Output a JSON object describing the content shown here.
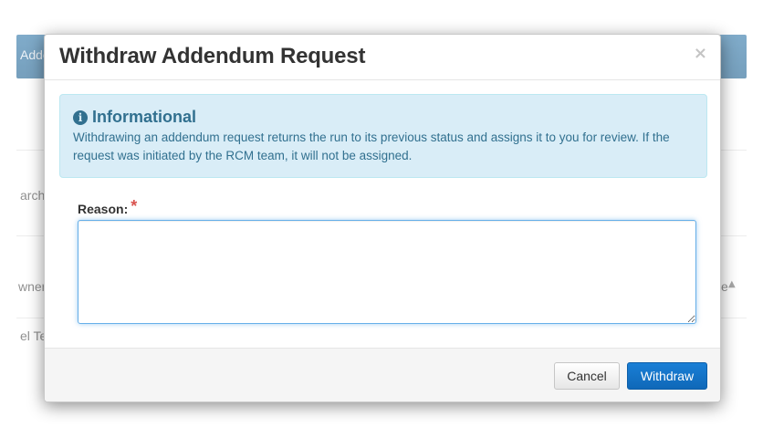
{
  "background": {
    "topbar_fragment": "Adde",
    "search_fragment": "arch",
    "owner_fragment": "wner",
    "row_fragment": "el Te",
    "col_fragment": "e",
    "sort_icon": "sort-up-icon"
  },
  "modal": {
    "title": "Withdraw Addendum Request",
    "close_label": "×",
    "info": {
      "icon": "info-circle-icon",
      "icon_glyph": "i",
      "heading": "Informational",
      "text": "Withdrawing an addendum request returns the run to its previous status and assigns it to you for review. If the request was initiated by the RCM team, it will not be assigned."
    },
    "reason": {
      "label": "Reason:",
      "required_mark": "*",
      "value": "",
      "placeholder": ""
    },
    "footer": {
      "cancel_label": "Cancel",
      "withdraw_label": "Withdraw"
    }
  },
  "colors": {
    "info_bg": "#d9edf7",
    "info_text": "#31708f",
    "primary": "#1a7fd6",
    "required": "#d9534f",
    "topbar": "#3c7fae"
  }
}
